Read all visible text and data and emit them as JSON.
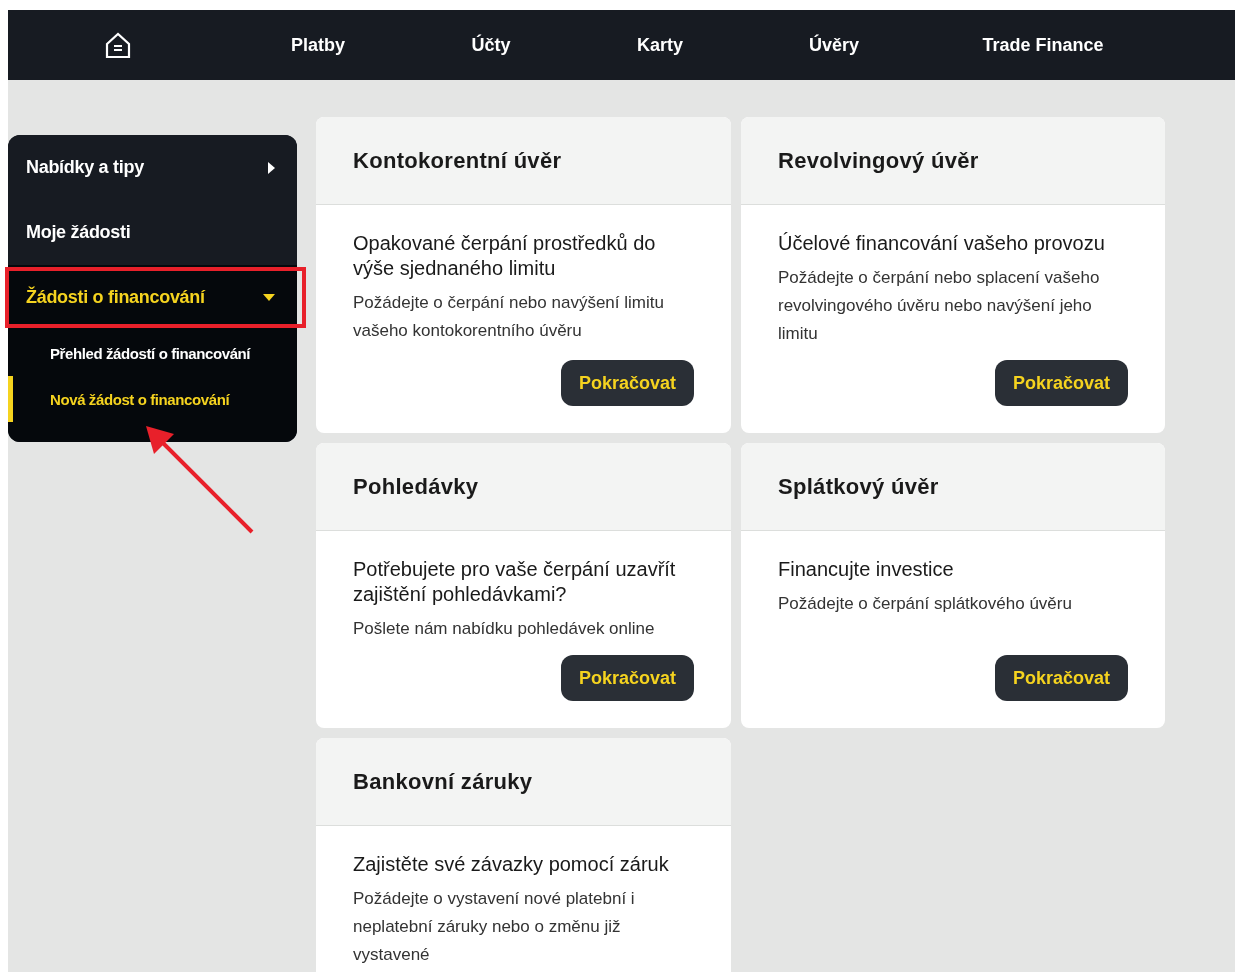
{
  "nav": {
    "items": [
      {
        "label": "Platby",
        "selected": false
      },
      {
        "label": "Účty",
        "selected": false
      },
      {
        "label": "Karty",
        "selected": false
      },
      {
        "label": "Úvěry",
        "selected": false
      },
      {
        "label": "Trade Finance",
        "selected": false
      }
    ]
  },
  "sidebar": {
    "items": [
      {
        "label": "Nabídky a tipy",
        "kind": "group",
        "expanded": false,
        "selected": false
      },
      {
        "label": "Moje žádosti",
        "kind": "link",
        "expanded": false,
        "selected": false
      },
      {
        "label": "Žádosti o financování",
        "kind": "group",
        "expanded": true,
        "selected": true,
        "children": [
          {
            "label": "Přehled žádostí o financování",
            "selected": false
          },
          {
            "label": "Nová žádost o financování",
            "selected": true
          }
        ]
      }
    ]
  },
  "cards": [
    {
      "title": "Kontokorentní úvěr",
      "heading": "Opakované čerpání prostředků do výše sjednaného limitu",
      "text": "Požádejte o čerpání nebo navýšení limitu vašeho kontokorentního úvěru",
      "button": "Pokračovat"
    },
    {
      "title": "Revolvingový úvěr",
      "heading": "Účelové financování vašeho provozu",
      "text": "Požádejte o čerpání nebo splacení vašeho revolvingového úvěru nebo navýšení jeho limitu",
      "button": "Pokračovat"
    },
    {
      "title": "Pohledávky",
      "heading": "Potřebujete pro vaše čerpání uzavřít zajištění pohledávkami?",
      "text": "Pošlete nám nabídku pohledávek online",
      "button": "Pokračovat"
    },
    {
      "title": "Splátkový úvěr",
      "heading": "Financujte investice",
      "text": "Požádejte o čerpání splátkového úvěru",
      "button": "Pokračovat"
    },
    {
      "title": "Bankovní záruky",
      "heading": "Zajistěte své závazky pomocí záruk",
      "text": "Požádejte o vystavení nové platební i neplatební záruky nebo o změnu již vystavené"
    }
  ]
}
